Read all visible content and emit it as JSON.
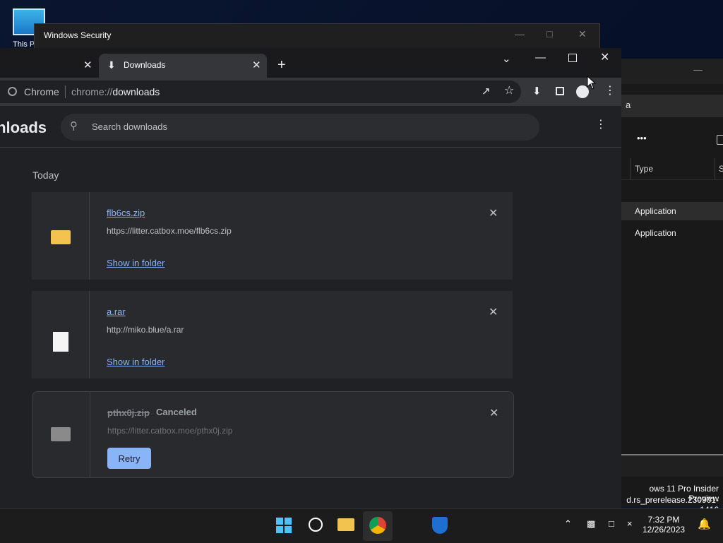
{
  "desktop": {
    "icon_label": "This P"
  },
  "winsec": {
    "title": "Windows Security"
  },
  "explorer": {
    "address_fragment": "a",
    "more_label": "•••",
    "columns": [
      "Type",
      "S"
    ],
    "rows": [
      "Application",
      "Application"
    ],
    "watermark_line1": "ows 11 Pro Insider Preview",
    "watermark_line2": "d.rs_prerelease.230901-1416"
  },
  "browser": {
    "active_tab_title": "Downloads",
    "omnibox": {
      "site_label": "Chrome",
      "scheme": "chrome://",
      "host": "downloads"
    }
  },
  "downloads": {
    "heading": "wnloads",
    "search_placeholder": "Search downloads",
    "section_date": "Today",
    "items": [
      {
        "name": "flb6cs.zip",
        "url": "https://litter.catbox.moe/flb6cs.zip",
        "action": "Show in folder"
      },
      {
        "name": "a.rar",
        "url": "http://miko.blue/a.rar",
        "action": "Show in folder"
      },
      {
        "name": "pthx0j.zip",
        "status": "Canceled",
        "url": "https://litter.catbox.moe/pthx0j.zip",
        "action": "Retry"
      }
    ]
  },
  "taskbar": {
    "time": "7:32 PM",
    "date": "12/26/2023"
  }
}
